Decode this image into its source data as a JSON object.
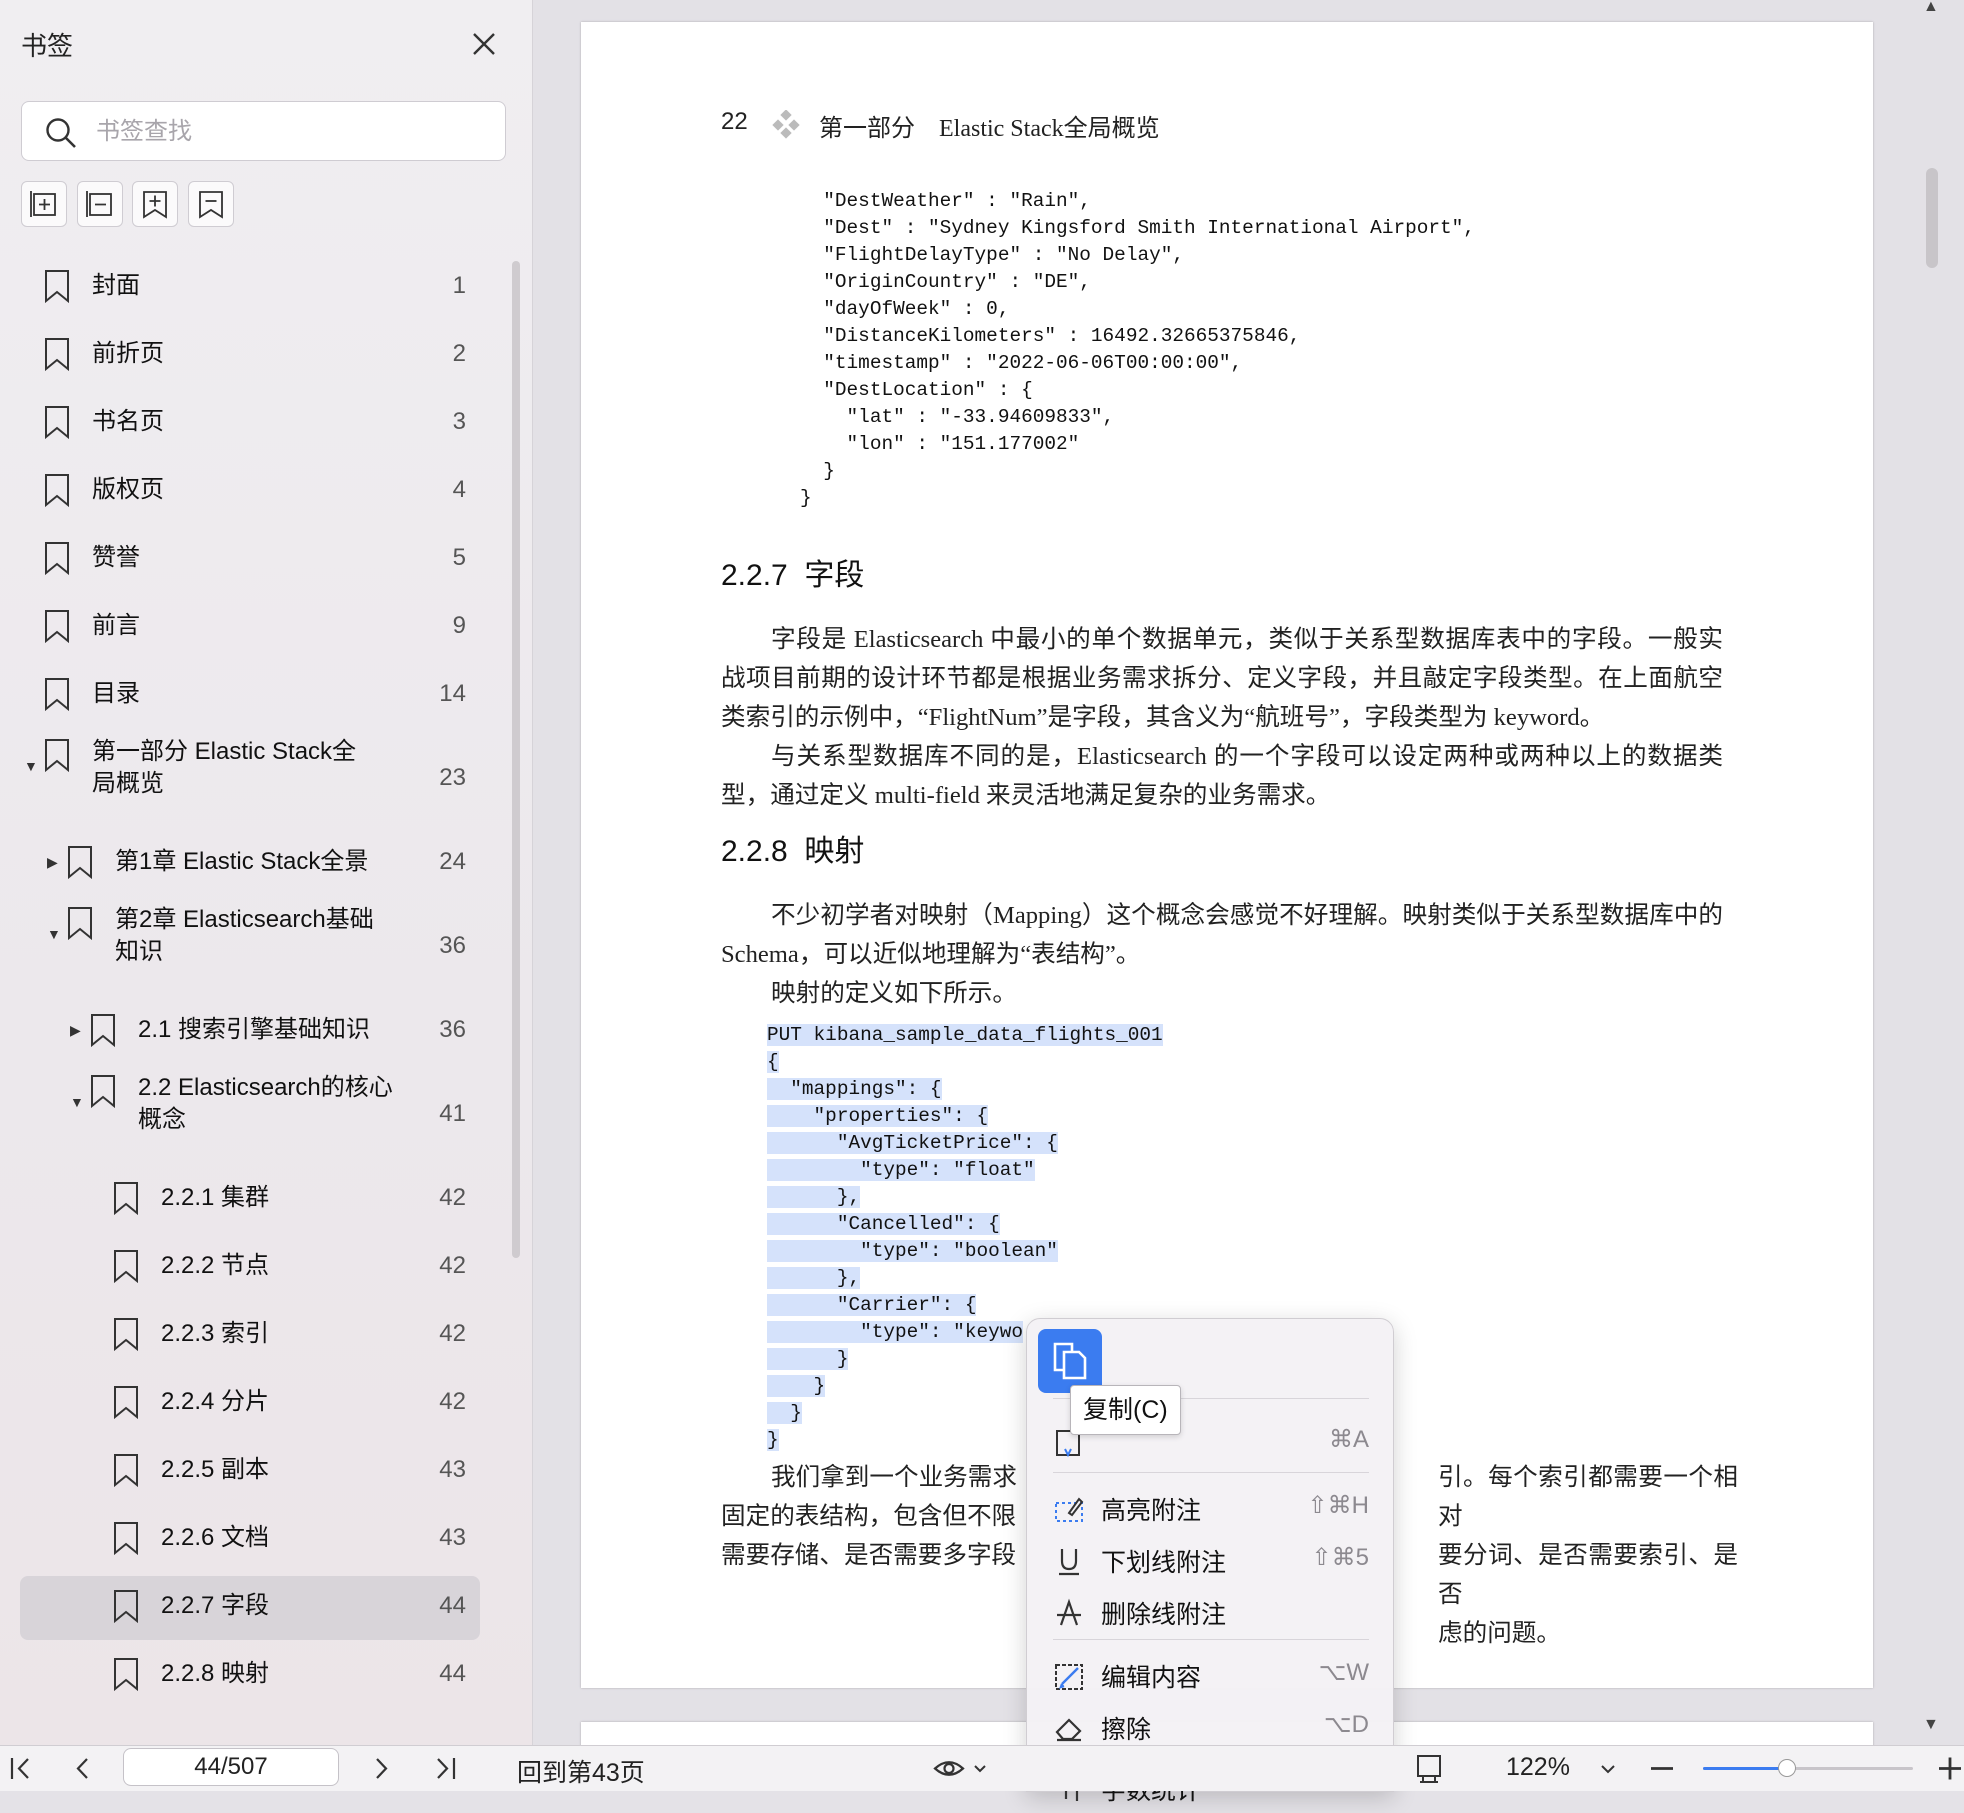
{
  "sidebar": {
    "title": "书签",
    "search_placeholder": "书签查找",
    "toolbar": [
      "expand-all",
      "collapse-all",
      "add-bookmark",
      "bookmark"
    ],
    "items": [
      {
        "label": "封面",
        "page": "1",
        "level": 0,
        "expander": ""
      },
      {
        "label": "前折页",
        "page": "2",
        "level": 0,
        "expander": ""
      },
      {
        "label": "书名页",
        "page": "3",
        "level": 0,
        "expander": ""
      },
      {
        "label": "版权页",
        "page": "4",
        "level": 0,
        "expander": ""
      },
      {
        "label": "赞誉",
        "page": "5",
        "level": 0,
        "expander": ""
      },
      {
        "label": "前言",
        "page": "9",
        "level": 0,
        "expander": ""
      },
      {
        "label": "目录",
        "page": "14",
        "level": 0,
        "expander": ""
      },
      {
        "label": "第一部分 Elastic Stack全局概览",
        "page": "23",
        "level": 0,
        "expander": "expanded"
      },
      {
        "label": "第1章 Elastic Stack全景",
        "page": "24",
        "level": 1,
        "expander": "collapsed"
      },
      {
        "label": "第2章 Elasticsearch基础知识",
        "page": "36",
        "level": 1,
        "expander": "expanded"
      },
      {
        "label": "2.1 搜索引擎基础知识",
        "page": "36",
        "level": 2,
        "expander": "collapsed"
      },
      {
        "label": "2.2 Elasticsearch的核心概念",
        "page": "41",
        "level": 2,
        "expander": "expanded"
      },
      {
        "label": "2.2.1 集群",
        "page": "42",
        "level": 3,
        "expander": ""
      },
      {
        "label": "2.2.2 节点",
        "page": "42",
        "level": 3,
        "expander": ""
      },
      {
        "label": "2.2.3 索引",
        "page": "42",
        "level": 3,
        "expander": ""
      },
      {
        "label": "2.2.4 分片",
        "page": "42",
        "level": 3,
        "expander": ""
      },
      {
        "label": "2.2.5 副本",
        "page": "43",
        "level": 3,
        "expander": ""
      },
      {
        "label": "2.2.6 文档",
        "page": "43",
        "level": 3,
        "expander": ""
      },
      {
        "label": "2.2.7 字段",
        "page": "44",
        "level": 3,
        "expander": "",
        "selected": true
      },
      {
        "label": "2.2.8 映射",
        "page": "44",
        "level": 3,
        "expander": ""
      }
    ]
  },
  "document": {
    "running_head": {
      "page_number": "22",
      "part": "第一部分",
      "title": "Elastic Stack全局概览"
    },
    "code_block_1": [
      "\"DestWeather\" : \"Rain\",",
      "\"Dest\" : \"Sydney Kingsford Smith International Airport\",",
      "\"FlightDelayType\" : \"No Delay\",",
      "\"OriginCountry\" : \"DE\",",
      "\"dayOfWeek\" : 0,",
      "\"DistanceKilometers\" : 16492.32665375846,",
      "\"timestamp\" : \"2022-06-06T00:00:00\",",
      "\"DestLocation\" : {",
      "  \"lat\" : \"-33.94609833\",",
      "  \"lon\" : \"151.177002\"",
      "}",
      "}"
    ],
    "section_227": {
      "number": "2.2.7",
      "title": "字段"
    },
    "para_227_1": "字段是 Elasticsearch 中最小的单个数据单元，类似于关系型数据库表中的字段。一般实战项目前期的设计环节都是根据业务需求拆分、定义字段，并且敲定字段类型。在上面航空类索引的示例中，“FlightNum”是字段，其含义为“航班号”，字段类型为 keyword。",
    "para_227_2": "与关系型数据库不同的是，Elasticsearch 的一个字段可以设定两种或两种以上的数据类型，通过定义 multi-field 来灵活地满足复杂的业务需求。",
    "section_228": {
      "number": "2.2.8",
      "title": "映射"
    },
    "para_228_1": "不少初学者对映射（Mapping）这个概念会感觉不好理解。映射类似于关系型数据库中的 Schema，可以近似地理解为“表结构”。",
    "para_228_2": "映射的定义如下所示。",
    "code_block_2": [
      "PUT kibana_sample_data_flights_001",
      "{",
      "  \"mappings\": {",
      "    \"properties\": {",
      "      \"AvgTicketPrice\": {",
      "        \"type\": \"float\"",
      "      },",
      "      \"Cancelled\": {",
      "        \"type\": \"boolean\"",
      "      },",
      "      \"Carrier\": {",
      "        \"type\": \"keywo",
      "      }",
      "    }",
      "  }",
      "}"
    ],
    "para_bottom_left": [
      "我们拿到一个业务需求",
      "固定的表结构，包含但不限",
      "需要存储、是否需要多字段"
    ],
    "para_bottom_right": [
      "引。每个索引都需要一个相对",
      "要分词、是否需要索引、是否",
      "虑的问题。"
    ]
  },
  "context_menu": {
    "copy_tooltip": "复制(C)",
    "items": [
      {
        "label": "",
        "shortcut": "⌘A",
        "icon": "select-all-icon"
      },
      {
        "label": "高亮附注",
        "shortcut": "⇧⌘H",
        "icon": "highlight-icon"
      },
      {
        "label": "下划线附注",
        "shortcut": "⇧⌘5",
        "icon": "underline-icon"
      },
      {
        "label": "删除线附注",
        "shortcut": "",
        "icon": "strikethrough-icon"
      },
      {
        "label": "编辑内容",
        "shortcut": "⌥W",
        "icon": "edit-icon"
      },
      {
        "label": "擦除",
        "shortcut": "⌥D",
        "icon": "eraser-icon"
      },
      {
        "label": "字数统计",
        "shortcut": "",
        "icon": "word-count-icon"
      }
    ]
  },
  "bottombar": {
    "page_value": "44/507",
    "back_to": "回到第43页",
    "zoom": "122%",
    "zoom_fraction": 0.4
  },
  "colors": {
    "accent": "#3b7cf0",
    "selection": "#d5e2fb",
    "selected_row": "#d8d4d9"
  }
}
